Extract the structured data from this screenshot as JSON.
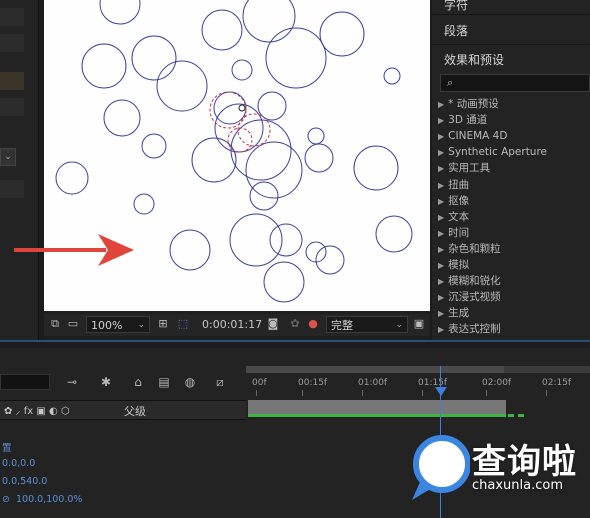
{
  "colors": {
    "accent_blue": "#3d7fe0",
    "circle_stroke": "#3a3fa0",
    "circle_selected": "#c23a4a",
    "arrow": "#e0443a",
    "green_bar": "#3fb33f"
  },
  "left_panel": {
    "dropdown_chevron": "⌄",
    "handle_chevron": "⌄"
  },
  "viewer": {
    "zoom": "100%",
    "timecode": "0:00:01:17",
    "resolution": "完整",
    "icons": [
      "snapshot-icon",
      "monitor-icon",
      "grid-icon",
      "mask-icon",
      "camera-icon",
      "color-icon",
      "channel-icon"
    ]
  },
  "effects_panel": {
    "tab_char": "字符",
    "tab_paragraph": "段落",
    "tab_effects": "效果和预设",
    "search_glyph": "⌕",
    "items": [
      "* 动画预设",
      "3D 通道",
      "CINEMA 4D",
      "Synthetic Aperture",
      "实用工具",
      "扭曲",
      "抠像",
      "文本",
      "时间",
      "杂色和颗粒",
      "模拟",
      "模糊和锐化",
      "沉浸式视频",
      "生成",
      "表达式控制"
    ]
  },
  "timeline": {
    "parent_header": "父级",
    "switch_icons": "✿ ⸝ fx ▣ ◐ ⬡",
    "ruler_labels": [
      "00f",
      "00:15f",
      "01:00f",
      "01:15f",
      "02:00f",
      "02:15f"
    ],
    "properties": {
      "position_label": "置",
      "anchor_value": "0.0,0.0",
      "position_value": "0.0,540.0",
      "scale_value": "100.0,100.0%"
    }
  },
  "watermark": {
    "text": "查询啦",
    "url": "chaxunla.com"
  }
}
